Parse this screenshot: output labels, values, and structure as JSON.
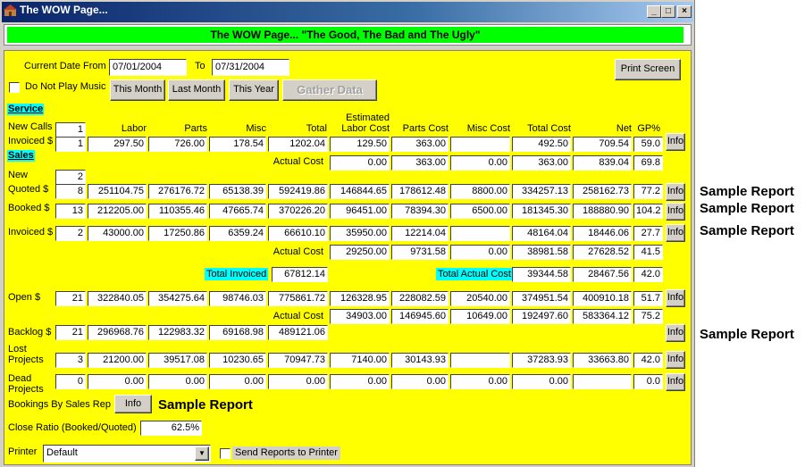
{
  "window": {
    "title": "The WOW Page...",
    "minimize": "_",
    "maximize": "□",
    "close": "×"
  },
  "banner": "The WOW Page... \"The Good, The Bad and The Ugly\"",
  "top": {
    "from_label": "Current Date From",
    "from_value": "07/01/2004",
    "to_label": "To",
    "to_value": "07/31/2004",
    "music_label": "Do Not Play Music",
    "this_month": "This Month",
    "last_month": "Last Month",
    "this_year": "This Year",
    "gather": "Gather Data",
    "print_screen": "Print Screen"
  },
  "headers": {
    "labor": "Labor",
    "parts": "Parts",
    "misc": "Misc",
    "total": "Total",
    "est1": "Estimated",
    "est2": "Labor Cost",
    "parts_cost": "Parts Cost",
    "misc_cost": "Misc Cost",
    "total_cost": "Total Cost",
    "net": "Net",
    "gp": "GP%"
  },
  "service": {
    "title": "Service",
    "new_calls_label": "New Calls",
    "new_calls": "1",
    "invoiced_label": "Invoiced $",
    "invoiced": [
      "1",
      "297.50",
      "726.00",
      "178.54",
      "1202.04",
      "129.50",
      "363.00",
      "",
      "492.50",
      "709.54",
      "59.0"
    ],
    "actual_cost_label": "Actual Cost",
    "actual": [
      "0.00",
      "363.00",
      "0.00",
      "363.00",
      "839.04",
      "69.8"
    ]
  },
  "sales": {
    "title": "Sales",
    "new_label": "New",
    "new_value": "2",
    "quoted_label": "Quoted $",
    "quoted": [
      "8",
      "251104.75",
      "276176.72",
      "65138.39",
      "592419.86",
      "146844.65",
      "178612.48",
      "8800.00",
      "334257.13",
      "258162.73",
      "77.2"
    ],
    "booked_label": "Booked $",
    "booked": [
      "13",
      "212205.00",
      "110355.46",
      "47665.74",
      "370226.20",
      "96451.00",
      "78394.30",
      "6500.00",
      "181345.30",
      "188880.90",
      "104.2"
    ],
    "invoiced_label": "Invoiced $",
    "invoiced": [
      "2",
      "43000.00",
      "17250.86",
      "6359.24",
      "66610.10",
      "35950.00",
      "12214.04",
      "",
      "48164.04",
      "18446.06",
      "27.7"
    ],
    "actual_cost_label": "Actual Cost",
    "actual": [
      "29250.00",
      "9731.58",
      "0.00",
      "38981.58",
      "27628.52",
      "41.5"
    ]
  },
  "totals": {
    "invoiced_label": "Total Invoiced",
    "invoiced": "67812.14",
    "actual_label": "Total Actual Cost",
    "actual": "39344.58",
    "net": "28467.56",
    "gp": "42.0"
  },
  "open": {
    "label": "Open $",
    "values": [
      "21",
      "322840.05",
      "354275.64",
      "98746.03",
      "775861.72",
      "126328.95",
      "228082.59",
      "20540.00",
      "374951.54",
      "400910.18",
      "51.7"
    ],
    "actual_cost_label": "Actual Cost",
    "actual": [
      "34903.00",
      "146945.60",
      "10649.00",
      "192497.60",
      "583364.12",
      "75.2"
    ]
  },
  "backlog": {
    "label": "Backlog $",
    "values": [
      "21",
      "296968.76",
      "122983.32",
      "69168.98",
      "489121.06"
    ]
  },
  "lost": {
    "label1": "Lost",
    "label2": "Projects",
    "values": [
      "3",
      "21200.00",
      "39517.08",
      "10230.65",
      "70947.73",
      "7140.00",
      "30143.93",
      "",
      "37283.93",
      "33663.80",
      "42.0"
    ]
  },
  "dead": {
    "label1": "Dead",
    "label2": "Projects",
    "values": [
      "0",
      "0.00",
      "0.00",
      "0.00",
      "0.00",
      "0.00",
      "0.00",
      "0.00",
      "0.00",
      "",
      "0.0"
    ]
  },
  "bookings_label": "Bookings By Sales Rep",
  "info": "Info",
  "sample_report": "Sample Report",
  "close_ratio_label": "Close Ratio (Booked/Quoted)",
  "close_ratio": "62.5%",
  "printer_label": "Printer",
  "printer_value": "Default",
  "send_reports_label": "Send Reports to Printer"
}
